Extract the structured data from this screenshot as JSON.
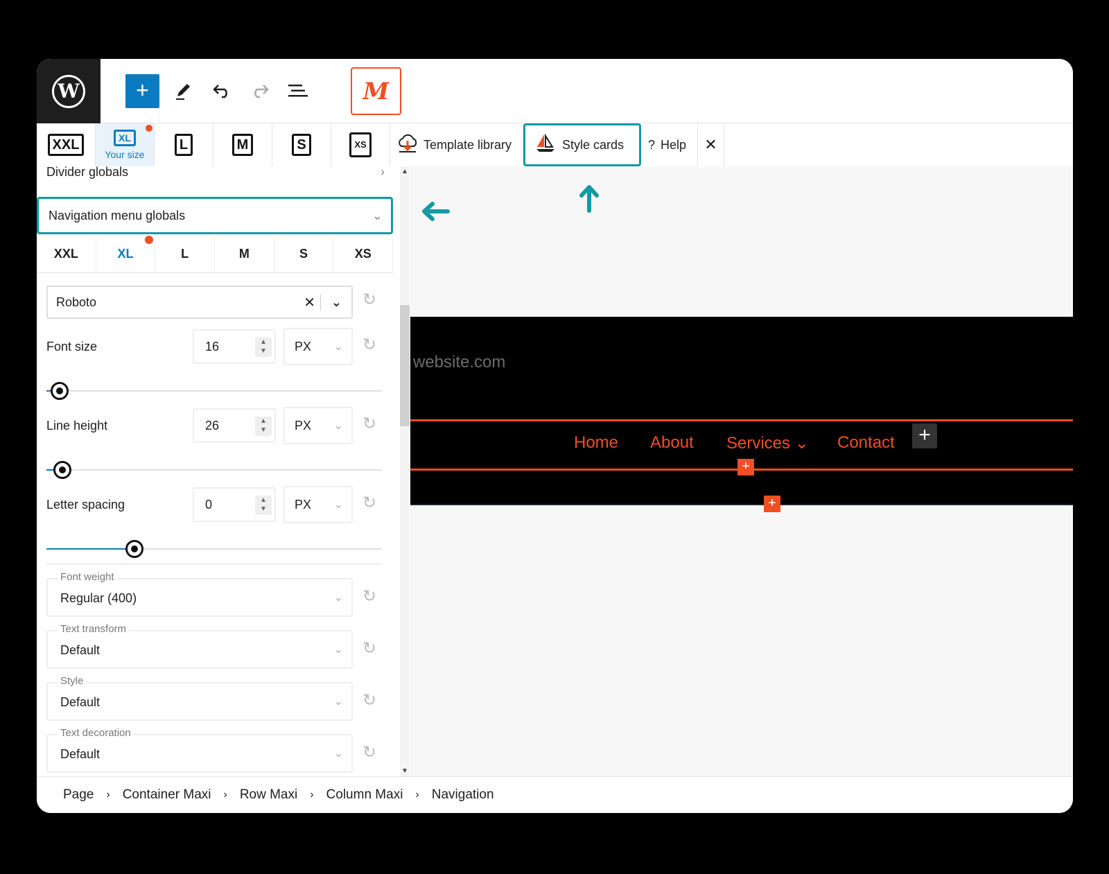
{
  "toolbar": {
    "wp_logo": "W",
    "add_symbol": "+",
    "maxi_logo": "M"
  },
  "responsive": {
    "items": [
      {
        "label": "XXL"
      },
      {
        "label": "XL",
        "sub": "Your size"
      },
      {
        "label": "L"
      },
      {
        "label": "M"
      },
      {
        "label": "S"
      },
      {
        "label": "XS"
      }
    ],
    "template_library": "Template library",
    "style_cards": "Style cards",
    "help": "Help",
    "close": "✕"
  },
  "sidebar": {
    "divider_globals": "Divider globals",
    "nav_menu_globals": "Navigation menu globals",
    "size_tabs": [
      "XXL",
      "XL",
      "L",
      "M",
      "S",
      "XS"
    ],
    "font_family": "Roboto",
    "font_size": {
      "label": "Font size",
      "value": "16",
      "unit": "PX"
    },
    "line_height": {
      "label": "Line height",
      "value": "26",
      "unit": "PX"
    },
    "letter_spacing": {
      "label": "Letter spacing",
      "value": "0",
      "unit": "PX"
    },
    "font_weight": {
      "label": "Font weight",
      "value": "Regular (400)"
    },
    "text_transform": {
      "label": "Text transform",
      "value": "Default"
    },
    "style": {
      "label": "Style",
      "value": "Default"
    },
    "text_decoration": {
      "label": "Text decoration",
      "value": "Default"
    }
  },
  "canvas": {
    "site_text": "website.com",
    "menu": [
      "Home",
      "About",
      "Services ⌄",
      "Contact"
    ]
  },
  "breadcrumb": [
    "Page",
    "Container Maxi",
    "Row Maxi",
    "Column Maxi",
    "Navigation"
  ],
  "colors": {
    "accent": "#f04e23",
    "wp_blue": "#0a7bc0",
    "highlight": "#139aa2"
  }
}
